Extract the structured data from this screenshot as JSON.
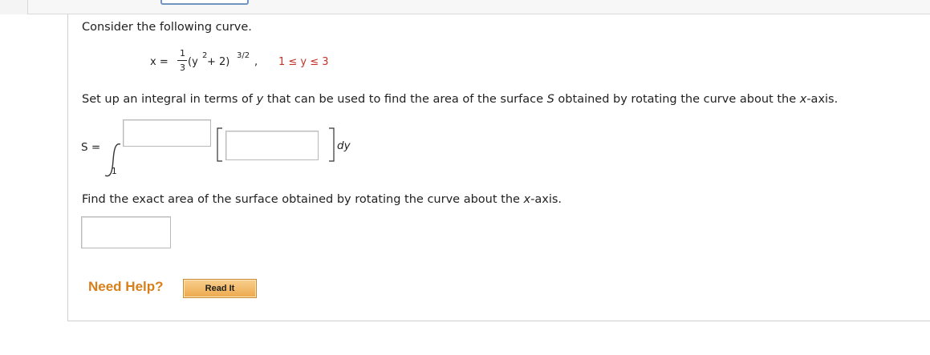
{
  "problem": {
    "intro": "Consider the following curve.",
    "equation": {
      "lhs": "x =",
      "frac_num": "1",
      "frac_den": "3",
      "body": "(y",
      "exp2": "2",
      "body2": " + 2)",
      "exp": "3/2",
      "comma": ",",
      "range": "1 ≤ y ≤ 3"
    },
    "setup_part1": "Set up an integral in terms of ",
    "setup_var": "y",
    "setup_part2": " that can be used to find the area of the surface ",
    "setup_S": "S",
    "setup_part3": " obtained by rotating the curve about the ",
    "setup_axis": "x",
    "setup_part4": "-axis.",
    "integral": {
      "lhs": "S =",
      "lower": "1",
      "dvar": "dy",
      "upper_value": "",
      "integrand_value": ""
    },
    "exact_part1": "Find the exact area of the surface obtained by rotating the curve about the ",
    "exact_axis": "x",
    "exact_part2": "-axis.",
    "answer_value": ""
  },
  "help": {
    "label": "Need Help?",
    "read_it": "Read It"
  }
}
